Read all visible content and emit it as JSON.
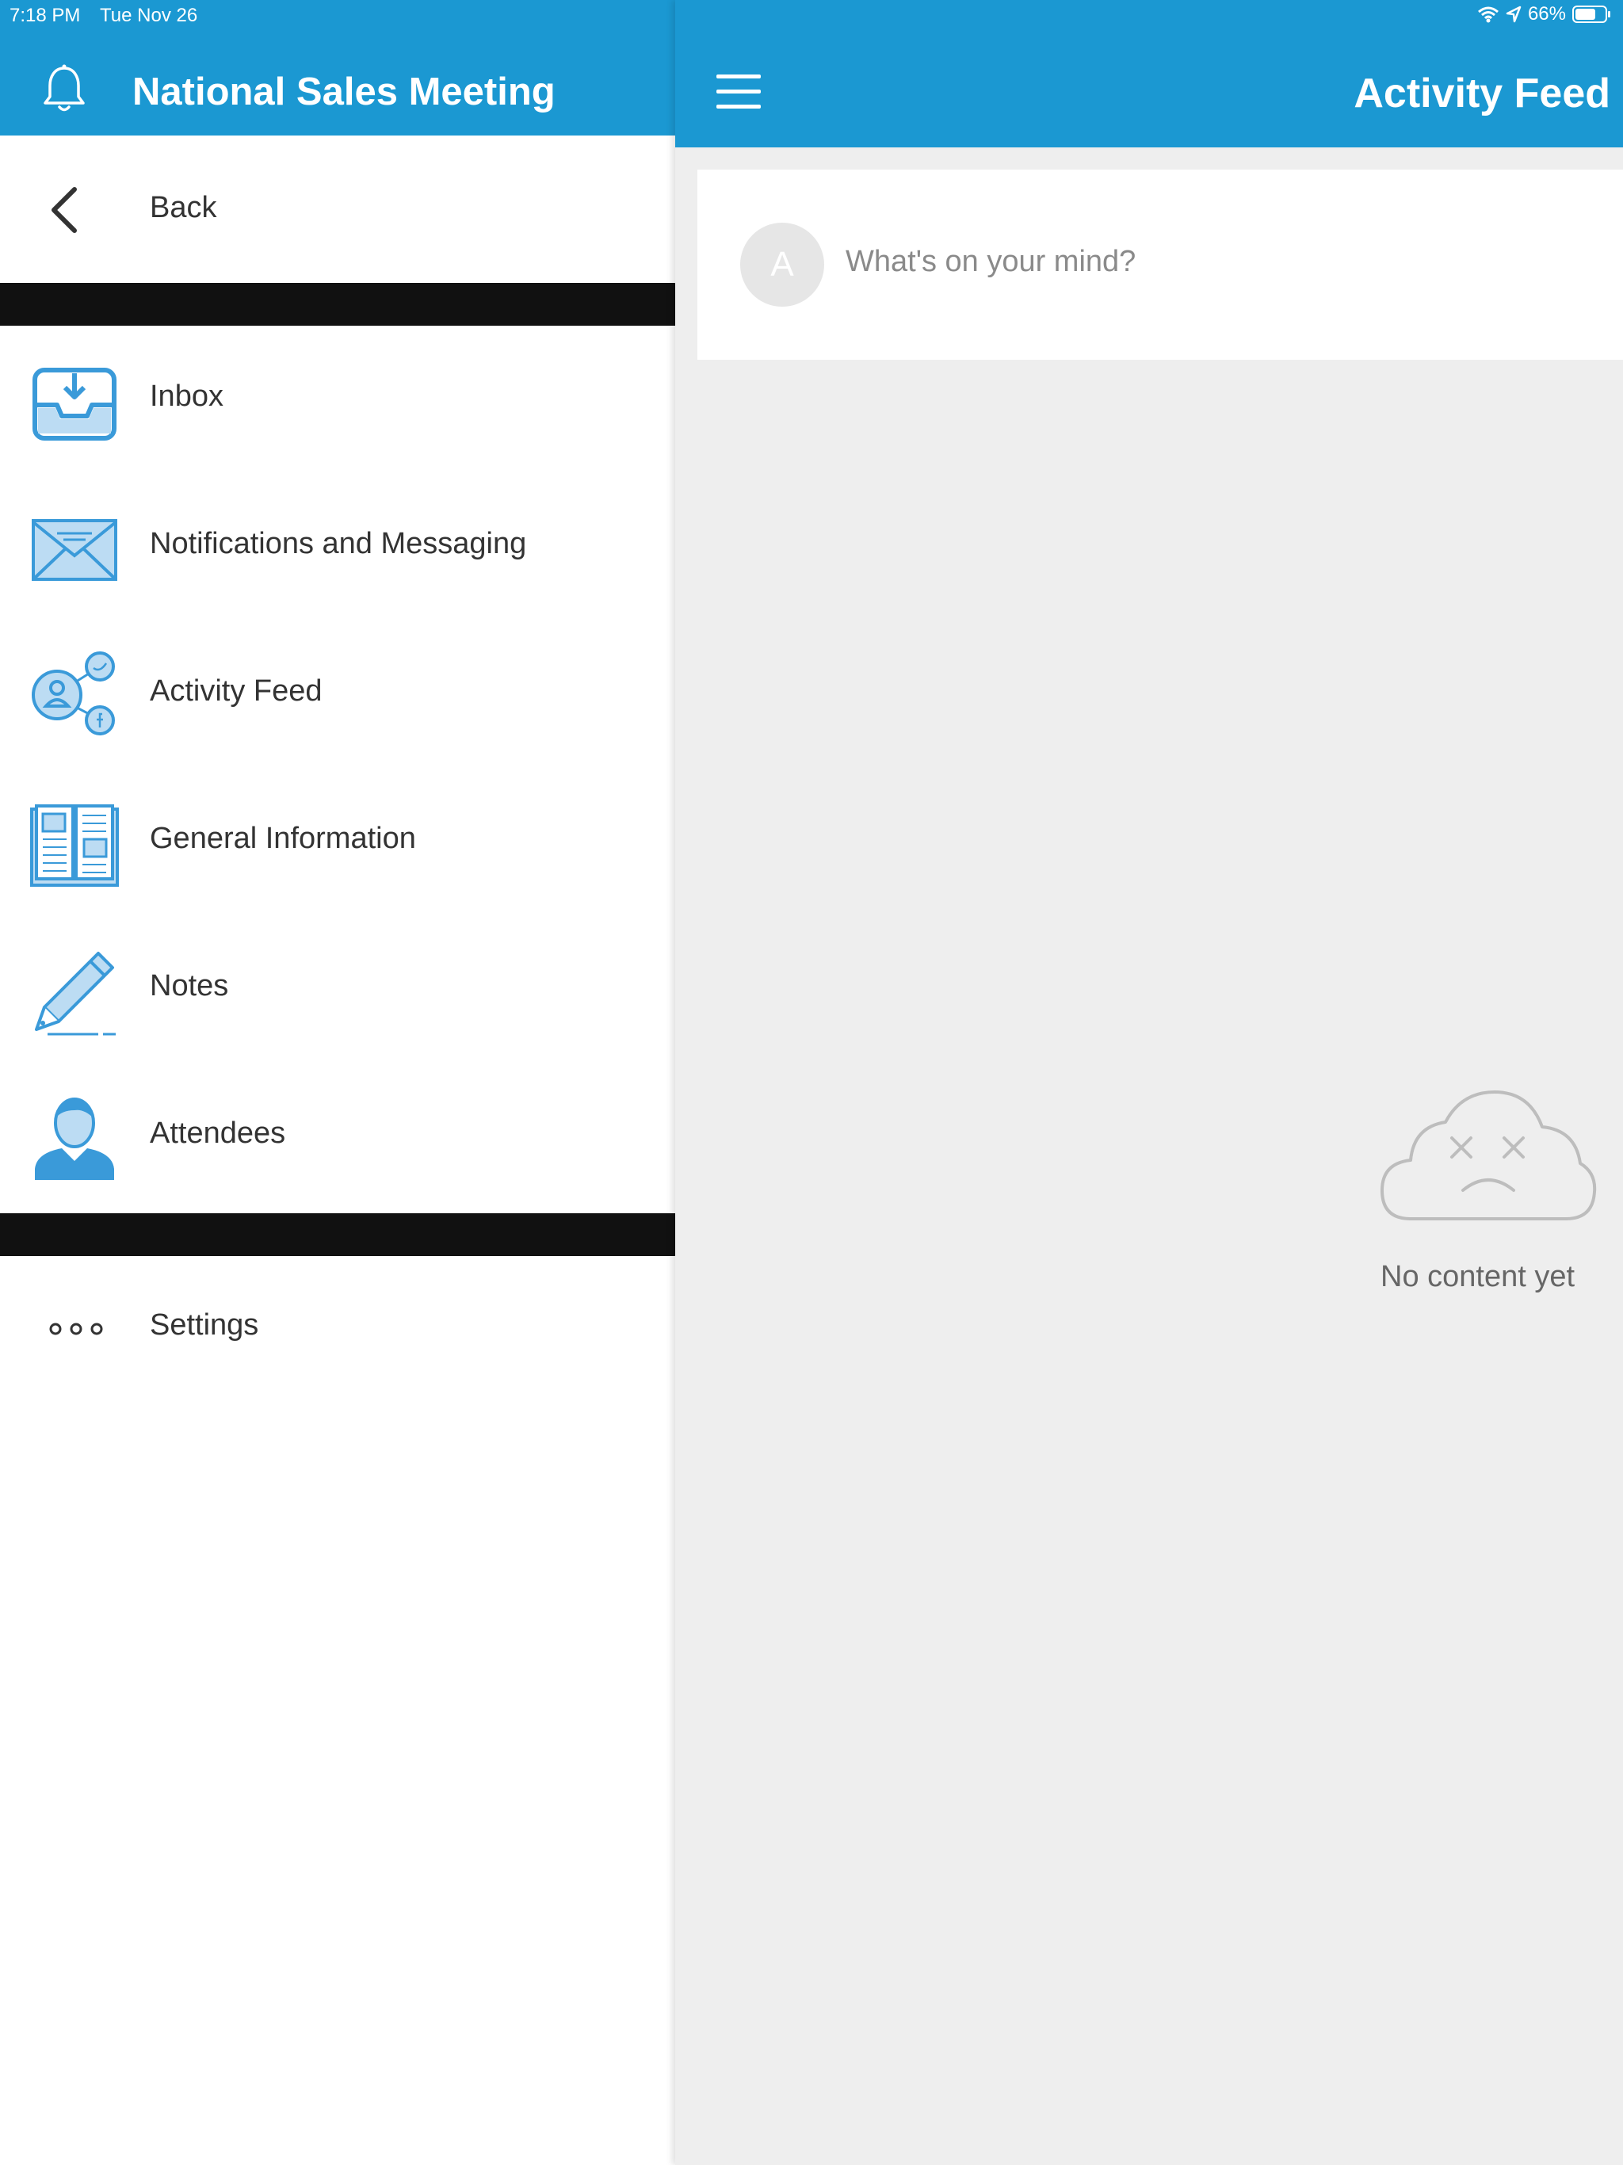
{
  "status_bar": {
    "time": "7:18 PM",
    "date": "Tue Nov 26",
    "battery": "66%",
    "icons": [
      "wifi-icon",
      "location-icon",
      "battery-icon"
    ]
  },
  "sidebar": {
    "title": "National Sales Meeting",
    "header_icon": "bell-icon",
    "back": {
      "label": "Back",
      "icon": "chevron-left-icon"
    },
    "items": [
      {
        "label": "Inbox",
        "icon": "inbox-tray-icon"
      },
      {
        "label": "Notifications and Messaging",
        "icon": "envelope-icon"
      },
      {
        "label": "Activity Feed",
        "icon": "social-share-icon"
      },
      {
        "label": "General Information",
        "icon": "open-book-icon"
      },
      {
        "label": "Notes",
        "icon": "pen-icon"
      },
      {
        "label": "Attendees",
        "icon": "person-icon"
      }
    ],
    "settings": {
      "label": "Settings",
      "icon": "more-dots-icon"
    }
  },
  "main": {
    "title": "Activity Feed",
    "menu_icon": "hamburger-icon",
    "composer": {
      "avatar_initial": "A",
      "placeholder": "What's on your mind?"
    },
    "empty_state": {
      "icon": "sad-cloud-icon",
      "text": "No content yet"
    }
  },
  "colors": {
    "header_blue": "#1b98d2",
    "icon_blue": "#3a9ad9",
    "icon_fill": "#bcdcf3",
    "divider": "#111111",
    "main_bg": "#eeeeee"
  }
}
